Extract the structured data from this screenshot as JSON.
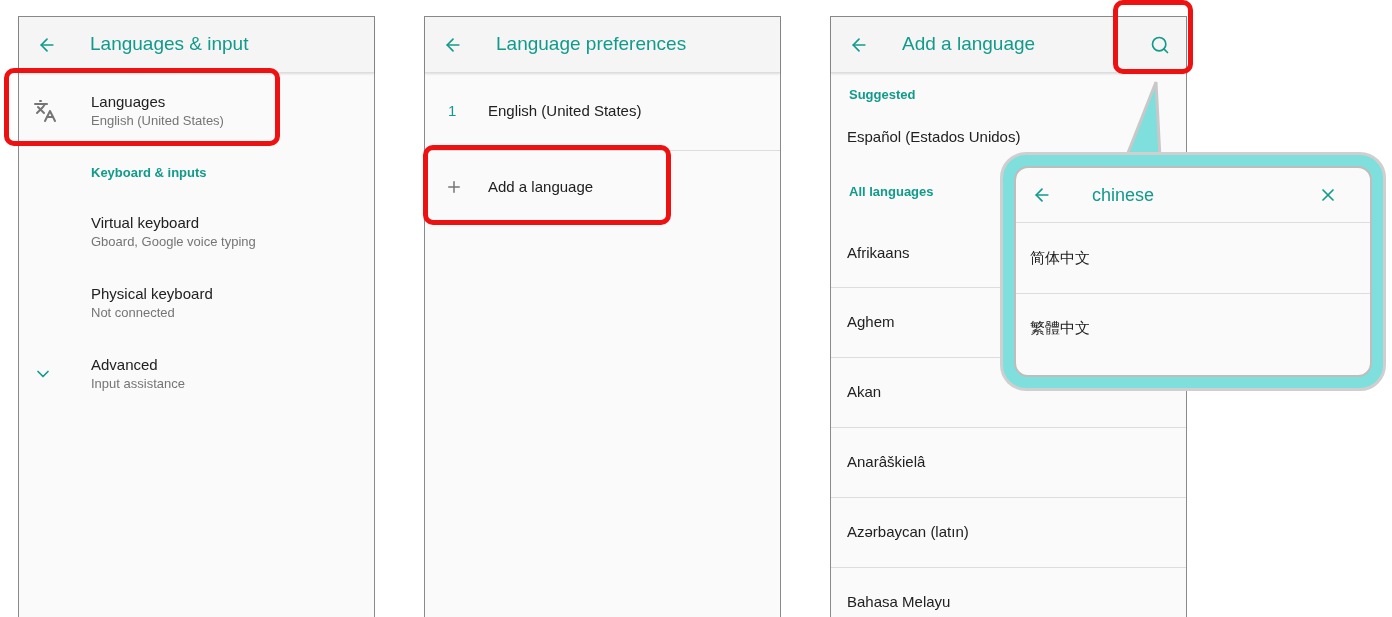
{
  "screens": [
    {
      "title": "Languages & input",
      "items": [
        {
          "kind": "translate",
          "title": "Languages",
          "subtitle": "English (United States)",
          "highlighted": true
        },
        {
          "kind": "section",
          "title": "Keyboard & inputs"
        },
        {
          "kind": "setting",
          "title": "Virtual keyboard",
          "subtitle": "Gboard, Google voice typing",
          "highlighted": false
        },
        {
          "kind": "setting",
          "title": "Physical keyboard",
          "subtitle": "Not connected",
          "highlighted": false
        },
        {
          "kind": "expander",
          "title": "Advanced",
          "subtitle": "Input assistance",
          "highlighted": false
        }
      ]
    },
    {
      "title": "Language preferences",
      "items": [
        {
          "kind": "numbered",
          "number": "1",
          "title": "English (United States)",
          "highlighted": false
        },
        {
          "kind": "add",
          "title": "Add a language",
          "highlighted": true
        }
      ]
    },
    {
      "title": "Add a language",
      "search_highlighted": true,
      "items": [
        {
          "kind": "section",
          "title": "Suggested"
        },
        {
          "kind": "language",
          "title": "Español (Estados Unidos)",
          "highlighted": false
        },
        {
          "kind": "section",
          "title": "All languages"
        },
        {
          "kind": "language",
          "title": "Afrikaans",
          "highlighted": false
        },
        {
          "kind": "language",
          "title": "Aghem",
          "highlighted": false
        },
        {
          "kind": "language",
          "title": "Akan",
          "highlighted": false
        },
        {
          "kind": "language",
          "title": "Anarâškielâ",
          "highlighted": false
        },
        {
          "kind": "language",
          "title": "Azərbaycan (latın)",
          "highlighted": false
        },
        {
          "kind": "language",
          "title": "Bahasa Melayu",
          "highlighted": false
        }
      ]
    }
  ],
  "callout": {
    "query": "chinese",
    "results": [
      "简体中文",
      "繁體中文"
    ]
  }
}
